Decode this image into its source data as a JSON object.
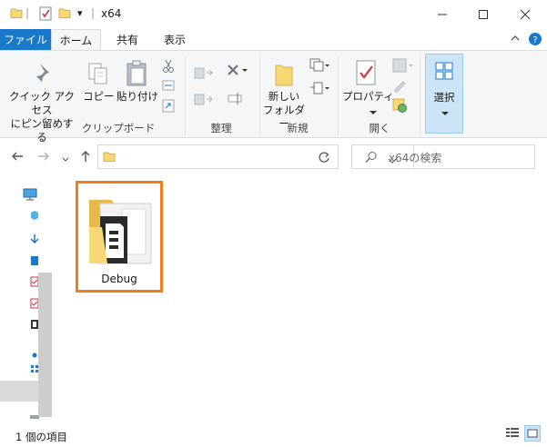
{
  "window": {
    "title": "x64",
    "quick_access_dropdown": "▾"
  },
  "tabs": {
    "file": "ファイル",
    "home": "ホーム",
    "share": "共有",
    "view": "表示"
  },
  "ribbon": {
    "pin_quick_access": "クイック アクセス\nにピン留めする",
    "copy": "コピー",
    "paste": "貼り付け",
    "group_clipboard": "クリップボード",
    "group_organize": "整理",
    "new_folder": "新しい\nフォルダー",
    "group_new": "新規",
    "properties": "プロパティ",
    "group_open": "開く",
    "select": "選択"
  },
  "address": {
    "path": "",
    "search_placeholder": "x64の検索"
  },
  "content": {
    "items": [
      {
        "name": "Debug",
        "type": "folder",
        "selected": true
      }
    ]
  },
  "status": {
    "item_count": "1 個の項目"
  },
  "colors": {
    "file_tab": "#1979ca",
    "highlight_border": "#f07d1a",
    "select_button_bg": "#cce4f7",
    "folder": "#f8d775"
  }
}
